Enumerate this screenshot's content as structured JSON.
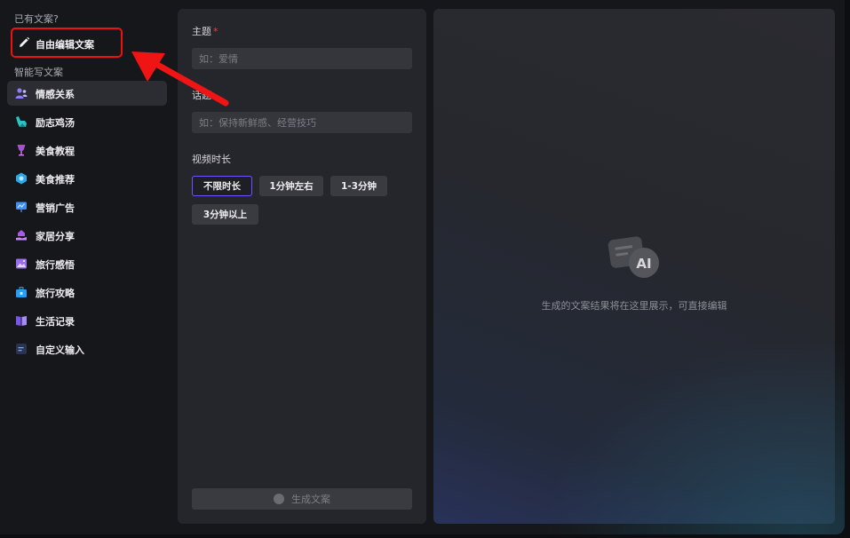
{
  "sidebar": {
    "existing_label": "已有文案?",
    "free_edit_label": "自由编辑文案",
    "smart_label": "智能写文案",
    "items": [
      {
        "label": "情感关系",
        "icon": "people-icon",
        "color": "#8f7bff",
        "active": true
      },
      {
        "label": "励志鸡汤",
        "icon": "muscle-arm-icon",
        "color": "#2bc3c3",
        "active": false
      },
      {
        "label": "美食教程",
        "icon": "wine-glass-icon",
        "color": "#b04bd8",
        "active": false
      },
      {
        "label": "美食推荐",
        "icon": "food-badge-icon",
        "color": "#2ea8e6",
        "active": false
      },
      {
        "label": "营销广告",
        "icon": "presentation-board-icon",
        "color": "#3d8ff2",
        "active": false
      },
      {
        "label": "家居分享",
        "icon": "home-hand-icon",
        "color": "#a45be8",
        "active": false
      },
      {
        "label": "旅行感悟",
        "icon": "photo-landscape-icon",
        "color": "#9a6cf0",
        "active": false
      },
      {
        "label": "旅行攻略",
        "icon": "suitcase-icon",
        "color": "#2b9df0",
        "active": false
      },
      {
        "label": "生活记录",
        "icon": "book-open-icon",
        "color": "#7a55e8",
        "active": false
      },
      {
        "label": "自定义输入",
        "icon": "text-edit-icon",
        "color": "#5a7bd8",
        "active": false
      }
    ]
  },
  "form": {
    "topic_label": "主题",
    "topic_required_mark": "*",
    "topic_placeholder": "如：爱情",
    "topic_value": "",
    "keywords_label": "话题",
    "keywords_placeholder": "如：保持新鲜感、经营技巧",
    "keywords_value": "",
    "duration_label": "视频时长",
    "durations": [
      {
        "label": "不限时长",
        "selected": true
      },
      {
        "label": "1分钟左右",
        "selected": false
      },
      {
        "label": "1-3分钟",
        "selected": false
      },
      {
        "label": "3分钟以上",
        "selected": false
      }
    ],
    "generate_label": "生成文案"
  },
  "result": {
    "hint": "生成的文案结果将在这里展示，可直接编辑",
    "badge_text": "AI"
  },
  "colors": {
    "accent": "#6c55ff",
    "highlight_red": "#e11111",
    "required_red": "#e0433a"
  }
}
